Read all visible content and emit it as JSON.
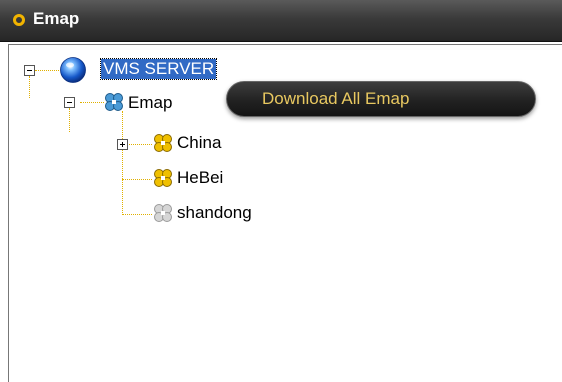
{
  "header": {
    "title": "Emap",
    "icon": "bullet-ring-icon",
    "accent": "#f2b400"
  },
  "tree": {
    "root": {
      "label": "VMS SERVER",
      "icon": "globe-icon",
      "expanded": true,
      "selected": true
    },
    "emap": {
      "label": "Emap",
      "icon": "puzzle-icon",
      "color": "#3a8ac0",
      "expanded": true
    },
    "children": [
      {
        "label": "China",
        "icon": "puzzle-icon",
        "color": "#e8b400",
        "expandable": true,
        "expanded": false
      },
      {
        "label": "HeBei",
        "icon": "puzzle-icon",
        "color": "#e8b400",
        "expandable": false
      },
      {
        "label": "shandong",
        "icon": "puzzle-icon",
        "color": "#c8c8c8",
        "expandable": false
      }
    ]
  },
  "context_menu": {
    "items": [
      {
        "label": "Download All Emap"
      }
    ],
    "text_color": "#e8c860"
  },
  "colors": {
    "selection": "#316ac5",
    "tree_line": "#e0b000",
    "header_bg": "#333333"
  }
}
